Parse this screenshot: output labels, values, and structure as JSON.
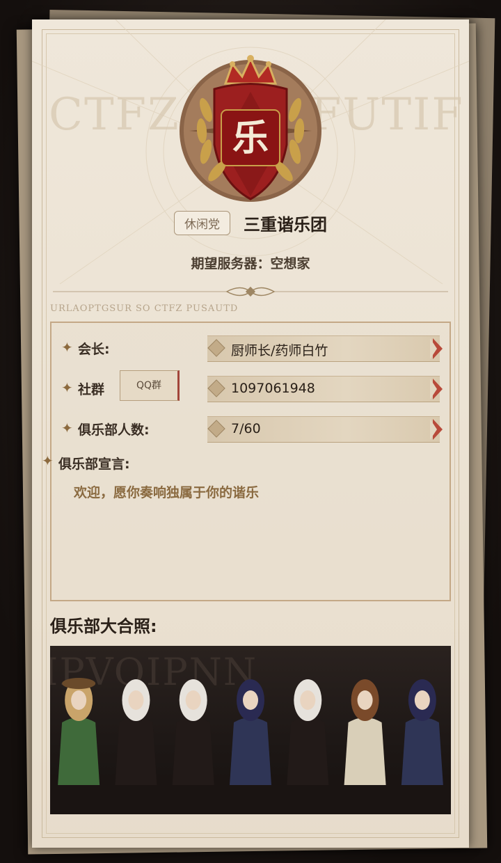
{
  "emblem": {
    "character": "乐"
  },
  "club": {
    "tag": "休闲党",
    "name": "三重谐乐团",
    "server": "期望服务器：空想家"
  },
  "decor": {
    "script_left": "CTFZ",
    "script_right": "FUTIF",
    "small_script": "URLAOPTGSUR SO CTFZ PUSAUTD"
  },
  "info": {
    "leader_label": "会长:",
    "leader_value": "厨师长/药师白竹",
    "community_label": "社群",
    "qq_button": "QQ群",
    "community_value": "1097061948",
    "members_label": "俱乐部人数:",
    "members_value": "7/60",
    "declaration_label": "俱乐部宣言:",
    "declaration_text": "欢迎，愿你奏响独属于你的谐乐"
  },
  "photo": {
    "title": "俱乐部大合照:",
    "bg_script": "IPVOIPNN",
    "characters": [
      {
        "outfit": "#3f6a3a",
        "hair": "#c9a46a",
        "hat": true
      },
      {
        "outfit": "#221a18",
        "hair": "#e6e2dc"
      },
      {
        "outfit": "#221a18",
        "hair": "#e6e2dc"
      },
      {
        "outfit": "#2f3556",
        "hair": "#2a2a52"
      },
      {
        "outfit": "#221a18",
        "hair": "#e6e2dc"
      },
      {
        "outfit": "#d9cfb8",
        "hair": "#7a4a2a"
      },
      {
        "outfit": "#2f3556",
        "hair": "#2a2a52"
      }
    ]
  },
  "colors": {
    "accent_red": "#9c1f1f",
    "gold": "#c9a04a"
  }
}
